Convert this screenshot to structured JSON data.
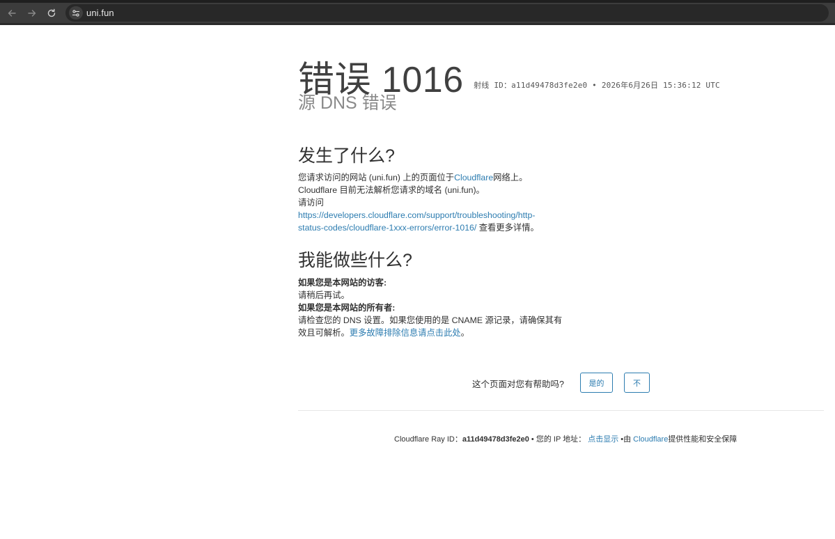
{
  "browser": {
    "url": "uni.fun"
  },
  "error": {
    "title": "错误 1016",
    "ray_label": "射线 ID：",
    "ray_id": "a11d49478d3fe2e0",
    "separator": "•",
    "timestamp": "2026年6月26日 15:36:12 UTC",
    "subtitle": "源 DNS 错误"
  },
  "what_happened": {
    "heading": "发生了什么?",
    "line1_prefix": "您请求访问的网站 (uni.fun) 上的页面位于",
    "line1_link": "Cloudflare",
    "line1_suffix": "网络上。",
    "line2": "Cloudflare 目前无法解析您请求的域名 (uni.fun)。",
    "line3": "请访问",
    "docs_link_line1": "https://developers.cloudflare.com/support/troubleshooting/http-",
    "docs_link_line2": "status-codes/cloudflare-1xxx-errors/error-1016/",
    "docs_suffix": " 查看更多详情。"
  },
  "what_can_i_do": {
    "heading": "我能做些什么?",
    "visitor_label": "如果您是本网站的访客:",
    "visitor_text": "请稍后再试。",
    "owner_label": "如果您是本网站的所有者:",
    "owner_text_line1": "请检查您的 DNS 设置。如果您使用的是 CNAME 源记录，请确保其有",
    "owner_text_line2": "效且可解析。",
    "owner_link": "更多故障排除信息请点击此处",
    "owner_suffix": "。"
  },
  "feedback": {
    "question": "这个页面对您有帮助吗?",
    "yes_label": "是的",
    "no_label": "不"
  },
  "footer": {
    "ray_label": "Cloudflare Ray ID：",
    "ray_id": "a11d49478d3fe2e0",
    "bullet1": " • ",
    "ip_label": "您的 IP 地址：",
    "ip_link": "点击显示",
    "bullet2": " •由 ",
    "cf_link": "Cloudflare",
    "powered_suffix": "提供性能和安全保障"
  }
}
